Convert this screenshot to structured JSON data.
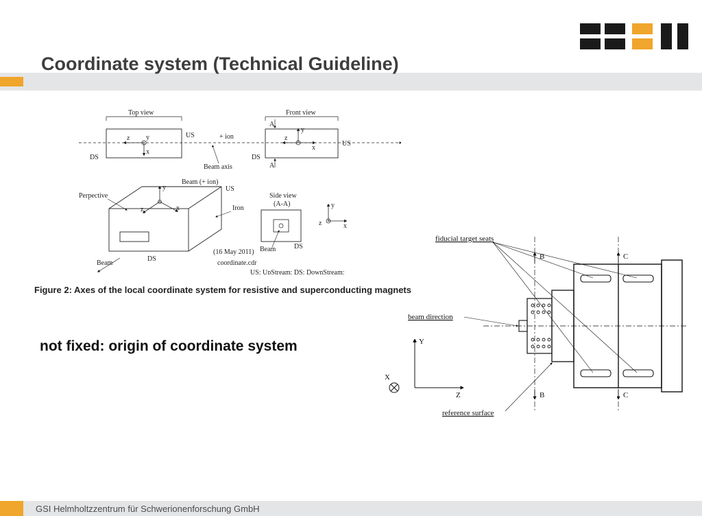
{
  "title": "Coordinate system (Technical Guideline)",
  "figure_caption": "Figure 2: Axes of the local coordinate system for resistive and superconducting magnets",
  "note": "not fixed: origin of coordinate system",
  "footer": "GSI Helmholtzzentrum für Schwerionenforschung GmbH",
  "diagram_top": {
    "top_view": "Top view",
    "front_view": "Front  view",
    "perspective": "Perpective",
    "side_view": "Side view",
    "side_view_aa": "(A-A)",
    "us": "US",
    "ds": "DS",
    "beam_axis": "Beam axis",
    "plus_ion": "+ ion",
    "beam_plus_ion": "Beam (+ ion)",
    "iron": "Iron",
    "beam": "Beam",
    "date": "(16 May 2011)",
    "file": "coordinate.cdr",
    "legend": "US: UpStream; DS: DownStream;",
    "a_mark": "A",
    "x": "x",
    "y": "y",
    "z": "z"
  },
  "diagram_right": {
    "fiducial": "fiducial target seats",
    "beam_dir": "beam direction",
    "ref_surface": "reference surface",
    "b": "B",
    "c": "C",
    "x": "X",
    "y": "Y",
    "z": "Z"
  },
  "colors": {
    "accent": "#f0a52c",
    "band": "#e4e5e6",
    "logo_dark": "#1a1a1a"
  }
}
